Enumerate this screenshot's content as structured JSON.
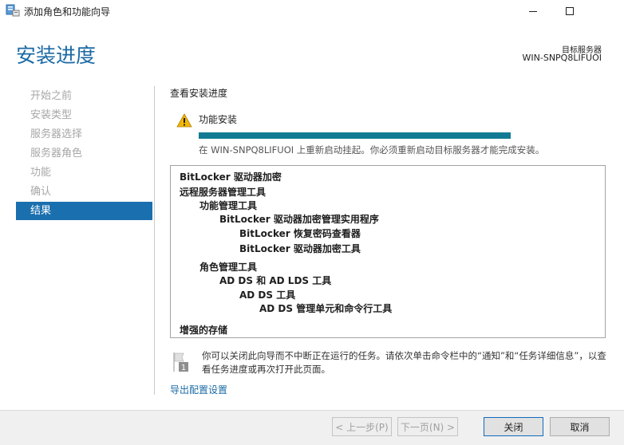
{
  "window": {
    "title": "添加角色和功能向导"
  },
  "header": {
    "page_title": "安装进度",
    "server_label": "目标服务器",
    "server_name": "WIN-SNPQ8LIFUOI"
  },
  "nav": {
    "items": [
      {
        "label": "开始之前",
        "active": false
      },
      {
        "label": "安装类型",
        "active": false
      },
      {
        "label": "服务器选择",
        "active": false
      },
      {
        "label": "服务器角色",
        "active": false
      },
      {
        "label": "功能",
        "active": false
      },
      {
        "label": "确认",
        "active": false
      },
      {
        "label": "结果",
        "active": true
      }
    ]
  },
  "main": {
    "section_heading": "查看安装进度",
    "status_label": "功能安装",
    "progress": 1.0,
    "status_message": "在 WIN-SNPQ8LIFUOI 上重新启动挂起。你必须重新启动目标服务器才能完成安装。",
    "results": [
      "BitLocker 驱动器加密",
      "远程服务器管理工具",
      "功能管理工具",
      "BitLocker 驱动器加密管理实用程序",
      "BitLocker 恢复密码查看器",
      "BitLocker 驱动器加密工具",
      "角色管理工具",
      "AD DS 和 AD LDS 工具",
      "AD DS 工具",
      "AD DS 管理单元和命令行工具",
      "增强的存储"
    ],
    "info_text": "你可以关闭此向导而不中断正在运行的任务。请依次单击命令栏中的“通知”和“任务详细信息”，以查看任务进度或再次打开此页面。",
    "export_link": "导出配置设置"
  },
  "footer": {
    "prev": "< 上一步(P)",
    "next": "下一页(N) >",
    "close": "关闭",
    "cancel": "取消"
  },
  "colors": {
    "accent": "#1a6faf",
    "title": "#1b6aa5",
    "progress": "#127b93",
    "warning": "#f2b705"
  },
  "icons": [
    "server-manager-icon",
    "minimize-icon",
    "maximize-icon",
    "warning-icon",
    "flag-icon"
  ]
}
